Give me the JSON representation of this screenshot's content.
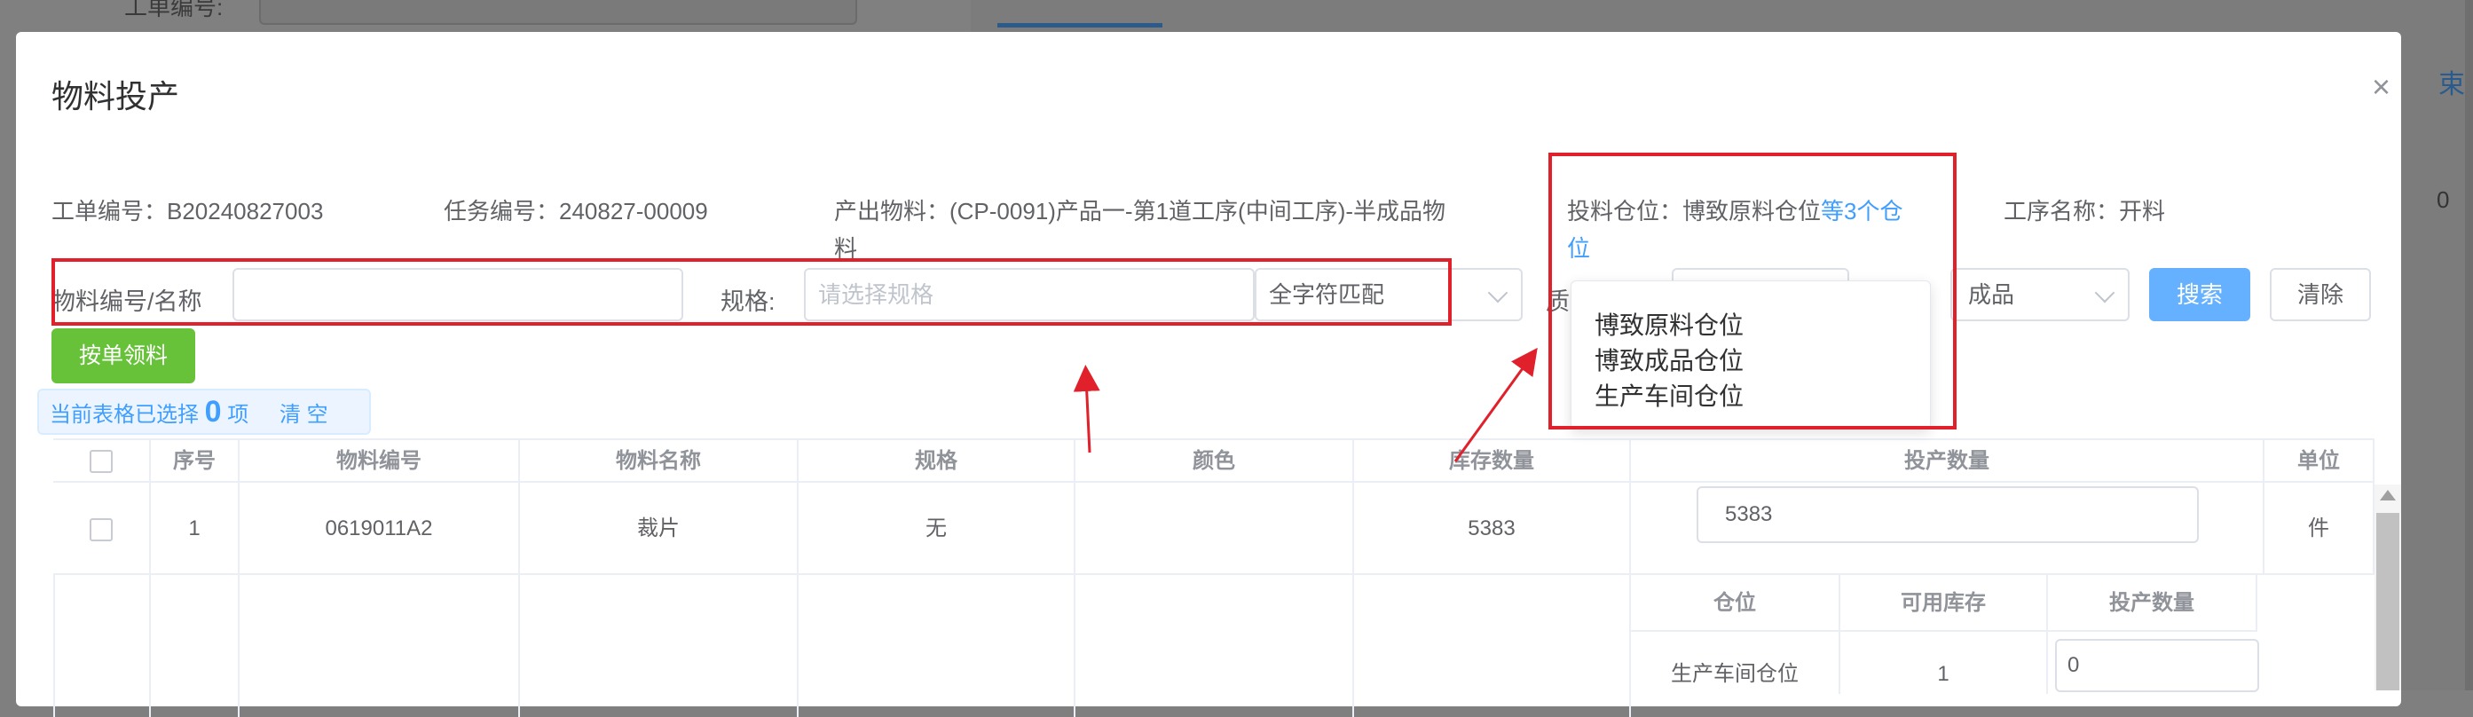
{
  "background": {
    "left_label": "工单编号:",
    "right_link": "束",
    "right_zero": "0"
  },
  "dialog": {
    "title": "物料投产",
    "close_glyph": "×"
  },
  "info": {
    "work_order": "工单编号：B20240827003",
    "task_no": "任务编号：240827-00009",
    "output_material_line1": "产出物料：(CP-0091)产品一-第1道工序(中间工序)-半成品物",
    "output_material_line2": "料",
    "warehouse_prefix": "投料仓位：博致原料仓位",
    "warehouse_link_line1": "等3个仓",
    "warehouse_link_line2": "位",
    "process_name": "工序名称：开料"
  },
  "filters": {
    "material_label": "物料编号/名称",
    "material_value": "",
    "spec_label": "规格:",
    "spec_placeholder": "请选择规格",
    "match_value": "全字符匹配",
    "quality_label_partial": "质",
    "type_value_partial": "成品",
    "search_label": "搜索",
    "clear_label": "清除",
    "by_order_label": "按单领料"
  },
  "selection": {
    "prefix": "当前表格已选择",
    "count": "0",
    "suffix": "项",
    "clear_link": "清 空"
  },
  "table": {
    "headers": [
      "序号",
      "物料编号",
      "物料名称",
      "规格",
      "颜色",
      "库存数量",
      "投产数量",
      "单位"
    ],
    "rows": [
      {
        "index": "1",
        "code": "0619011A2",
        "name": "裁片",
        "spec": "无",
        "color": "",
        "stock": "5383",
        "qty": "5383",
        "unit": "件"
      }
    ],
    "sub_headers": [
      "仓位",
      "可用库存",
      "投产数量"
    ],
    "sub_rows": [
      {
        "location": "生产车间仓位",
        "available": "1",
        "qty": "0"
      }
    ]
  },
  "popover": {
    "items": [
      "博致原料仓位",
      "博致成品仓位",
      "生产车间仓位"
    ]
  },
  "colors": {
    "accent": "#409eff",
    "annotation_red": "#e0202a",
    "green_button": "#67c23a"
  }
}
